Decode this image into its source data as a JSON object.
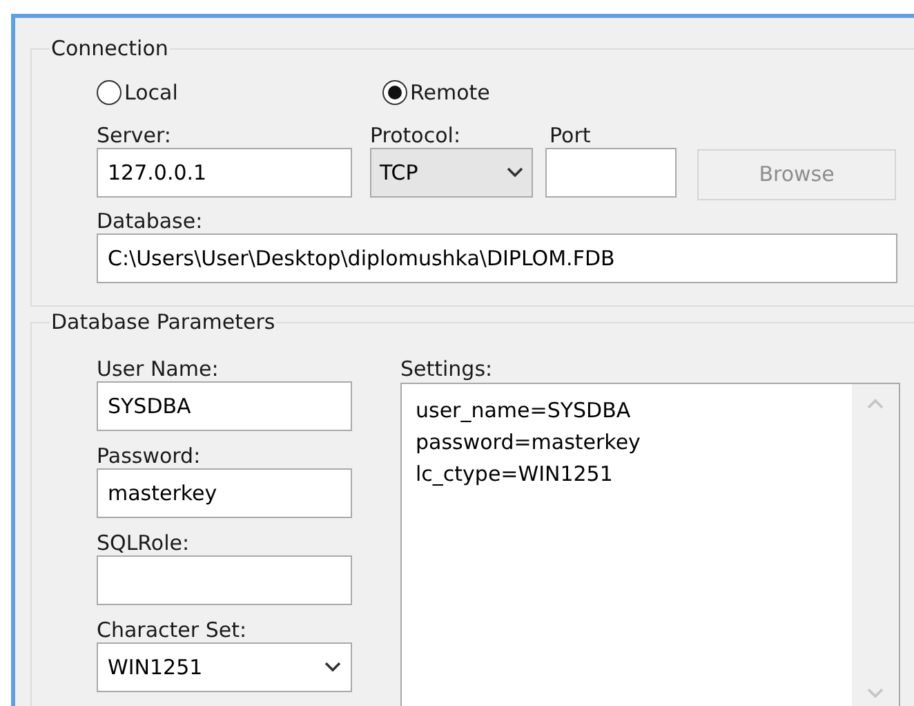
{
  "connection": {
    "title": "Connection",
    "modes": [
      {
        "label": "Local",
        "selected": false
      },
      {
        "label": "Remote",
        "selected": true
      }
    ],
    "server": {
      "label": "Server:",
      "value": "127.0.0.1"
    },
    "protocol": {
      "label": "Protocol:",
      "value": "TCP"
    },
    "port": {
      "label": "Port"
    },
    "browse": {
      "label": "Browse",
      "disabled": true
    },
    "database": {
      "label": "Database:",
      "value": "C:\\Users\\User\\Desktop\\diplomushka\\DIPLOM.FDB"
    }
  },
  "parameters": {
    "title": "Database Parameters",
    "user_name": {
      "label": "User Name:",
      "value": "SYSDBA"
    },
    "password": {
      "label": "Password:",
      "value": "masterkey"
    },
    "sql_role": {
      "label": "SQLRole:"
    },
    "character_set": {
      "label": "Character Set:",
      "value": "WIN1251"
    },
    "settings": {
      "label": "Settings:",
      "lines": [
        "user_name=SYSDBA",
        "password=masterkey",
        "lc_ctype=WIN1251"
      ]
    }
  }
}
